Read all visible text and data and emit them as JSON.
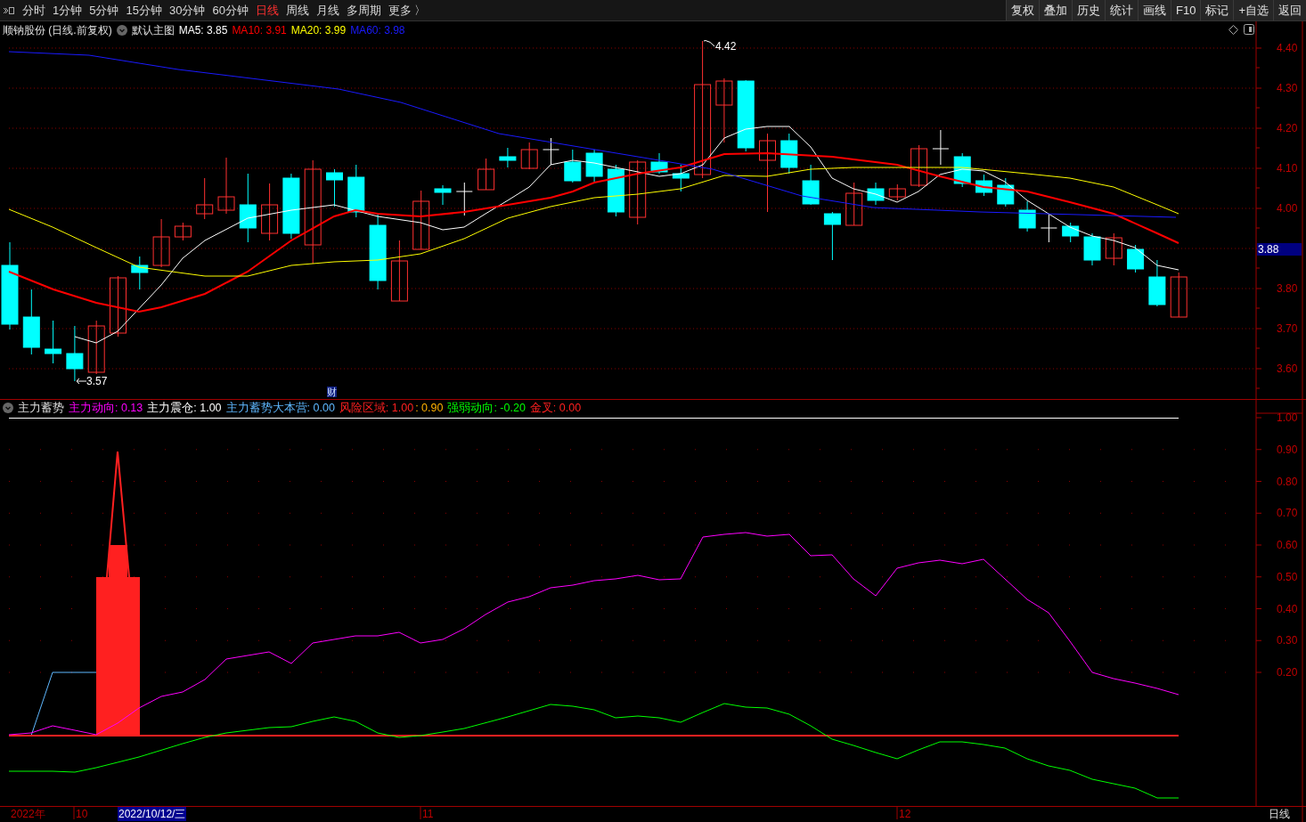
{
  "toolbar": {
    "periods": [
      {
        "label": "分时",
        "selected": false
      },
      {
        "label": "1分钟",
        "selected": false
      },
      {
        "label": "5分钟",
        "selected": false
      },
      {
        "label": "15分钟",
        "selected": false
      },
      {
        "label": "30分钟",
        "selected": false
      },
      {
        "label": "60分钟",
        "selected": false
      },
      {
        "label": "日线",
        "selected": true
      },
      {
        "label": "周线",
        "selected": false
      },
      {
        "label": "月线",
        "selected": false
      },
      {
        "label": "多周期",
        "selected": false
      },
      {
        "label": "更多 〉",
        "selected": false
      }
    ],
    "buttons": [
      "复权",
      "叠加",
      "历史",
      "统计",
      "画线",
      "F10",
      "标记",
      "+自选",
      "返回"
    ]
  },
  "main_chart": {
    "title": "顺钠股份 (日线.前复权)",
    "template": "默认主图",
    "ma": [
      {
        "label": "MA5: 3.85",
        "color": "#ffffff"
      },
      {
        "label": "MA10: 3.91",
        "color": "#ff0000"
      },
      {
        "label": "MA20: 3.99",
        "color": "#ffff00"
      },
      {
        "label": "MA60: 3.98",
        "color": "#1a1aff"
      }
    ],
    "y_labels": [
      "4.40",
      "4.30",
      "4.20",
      "4.10",
      "4.00",
      "3.80",
      "3.70",
      "3.60"
    ],
    "current_price": "3.88",
    "high_label": "4.42",
    "low_label": "3.57",
    "event_marker": "财"
  },
  "indicator": {
    "name": "主力蓄势",
    "values": [
      {
        "label": "主力动向: 0.13",
        "color": "#ff00ff"
      },
      {
        "label": "主力震仓: 1.00",
        "color": "#ffffff"
      },
      {
        "label": "主力蓄势大本营: 0.00",
        "color": "#5fb8ff"
      },
      {
        "label": "风险区域: 1.00",
        "color": "#ff2020"
      },
      {
        "label": ": 0.90",
        "color": "#ffb000"
      },
      {
        "label": "强弱动向: -0.20",
        "color": "#00ff00"
      },
      {
        "label": "金叉: 0.00",
        "color": "#ff2020"
      }
    ],
    "y_labels": [
      "1.00",
      "0.90",
      "0.80",
      "0.70",
      "0.60",
      "0.50",
      "0.40",
      "0.30",
      "0.20"
    ]
  },
  "time_axis": {
    "labels": [
      "2022年",
      "10",
      "11",
      "12"
    ],
    "cursor_date": "2022/10/12/三",
    "period_label": "日线"
  }
}
